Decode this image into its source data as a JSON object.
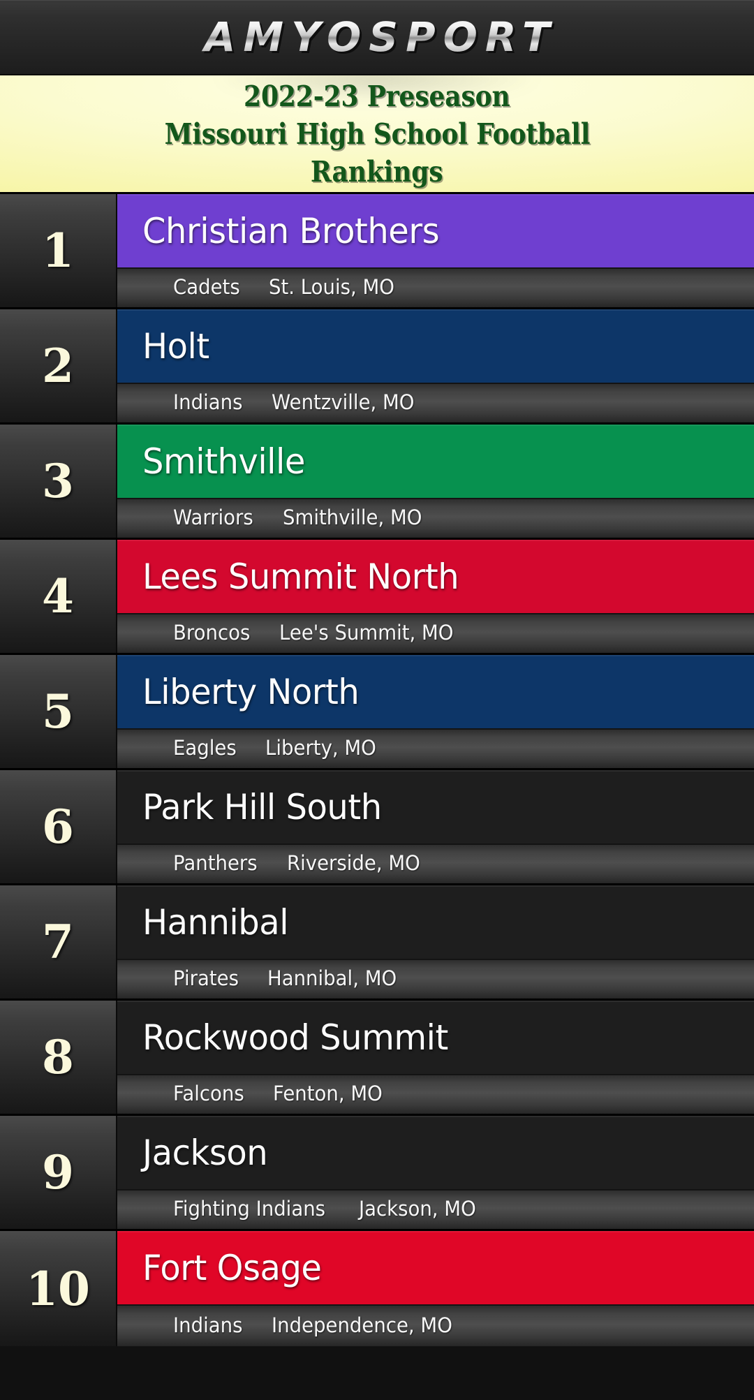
{
  "brand": {
    "name": "AMYOSPORT"
  },
  "title": {
    "line1": "2022-23 Preseason",
    "line2": "Missouri High School Football",
    "line3": "Rankings",
    "color": "#13571b",
    "background": "#fbfbcf"
  },
  "rankings": [
    {
      "rank": "1",
      "team": "Christian Brothers",
      "mascot": "Cadets",
      "city": "St. Louis, MO",
      "color": "#6f3fd0"
    },
    {
      "rank": "2",
      "team": "Holt",
      "mascot": "Indians",
      "city": "Wentzville, MO",
      "color": "#0d3668"
    },
    {
      "rank": "3",
      "team": "Smithville",
      "mascot": "Warriors",
      "city": "Smithville, MO",
      "color": "#07914f"
    },
    {
      "rank": "4",
      "team": "Lees Summit North",
      "mascot": "Broncos",
      "city": "Lee's Summit, MO",
      "color": "#d3082e"
    },
    {
      "rank": "5",
      "team": "Liberty North",
      "mascot": "Eagles",
      "city": "Liberty, MO",
      "color": "#0d3668"
    },
    {
      "rank": "6",
      "team": "Park Hill South",
      "mascot": "Panthers",
      "city": "Riverside, MO",
      "color": "#1e1e1e"
    },
    {
      "rank": "7",
      "team": "Hannibal",
      "mascot": "Pirates",
      "city": "Hannibal, MO",
      "color": "#1e1e1e"
    },
    {
      "rank": "8",
      "team": "Rockwood Summit",
      "mascot": "Falcons",
      "city": "Fenton, MO",
      "color": "#1e1e1e"
    },
    {
      "rank": "9",
      "team": "Jackson",
      "mascot": "Fighting Indians",
      "city": "Jackson, MO",
      "color": "#1e1e1e"
    },
    {
      "rank": "10",
      "team": "Fort Osage",
      "mascot": "Indians",
      "city": "Independence, MO",
      "color": "#e00627"
    }
  ]
}
